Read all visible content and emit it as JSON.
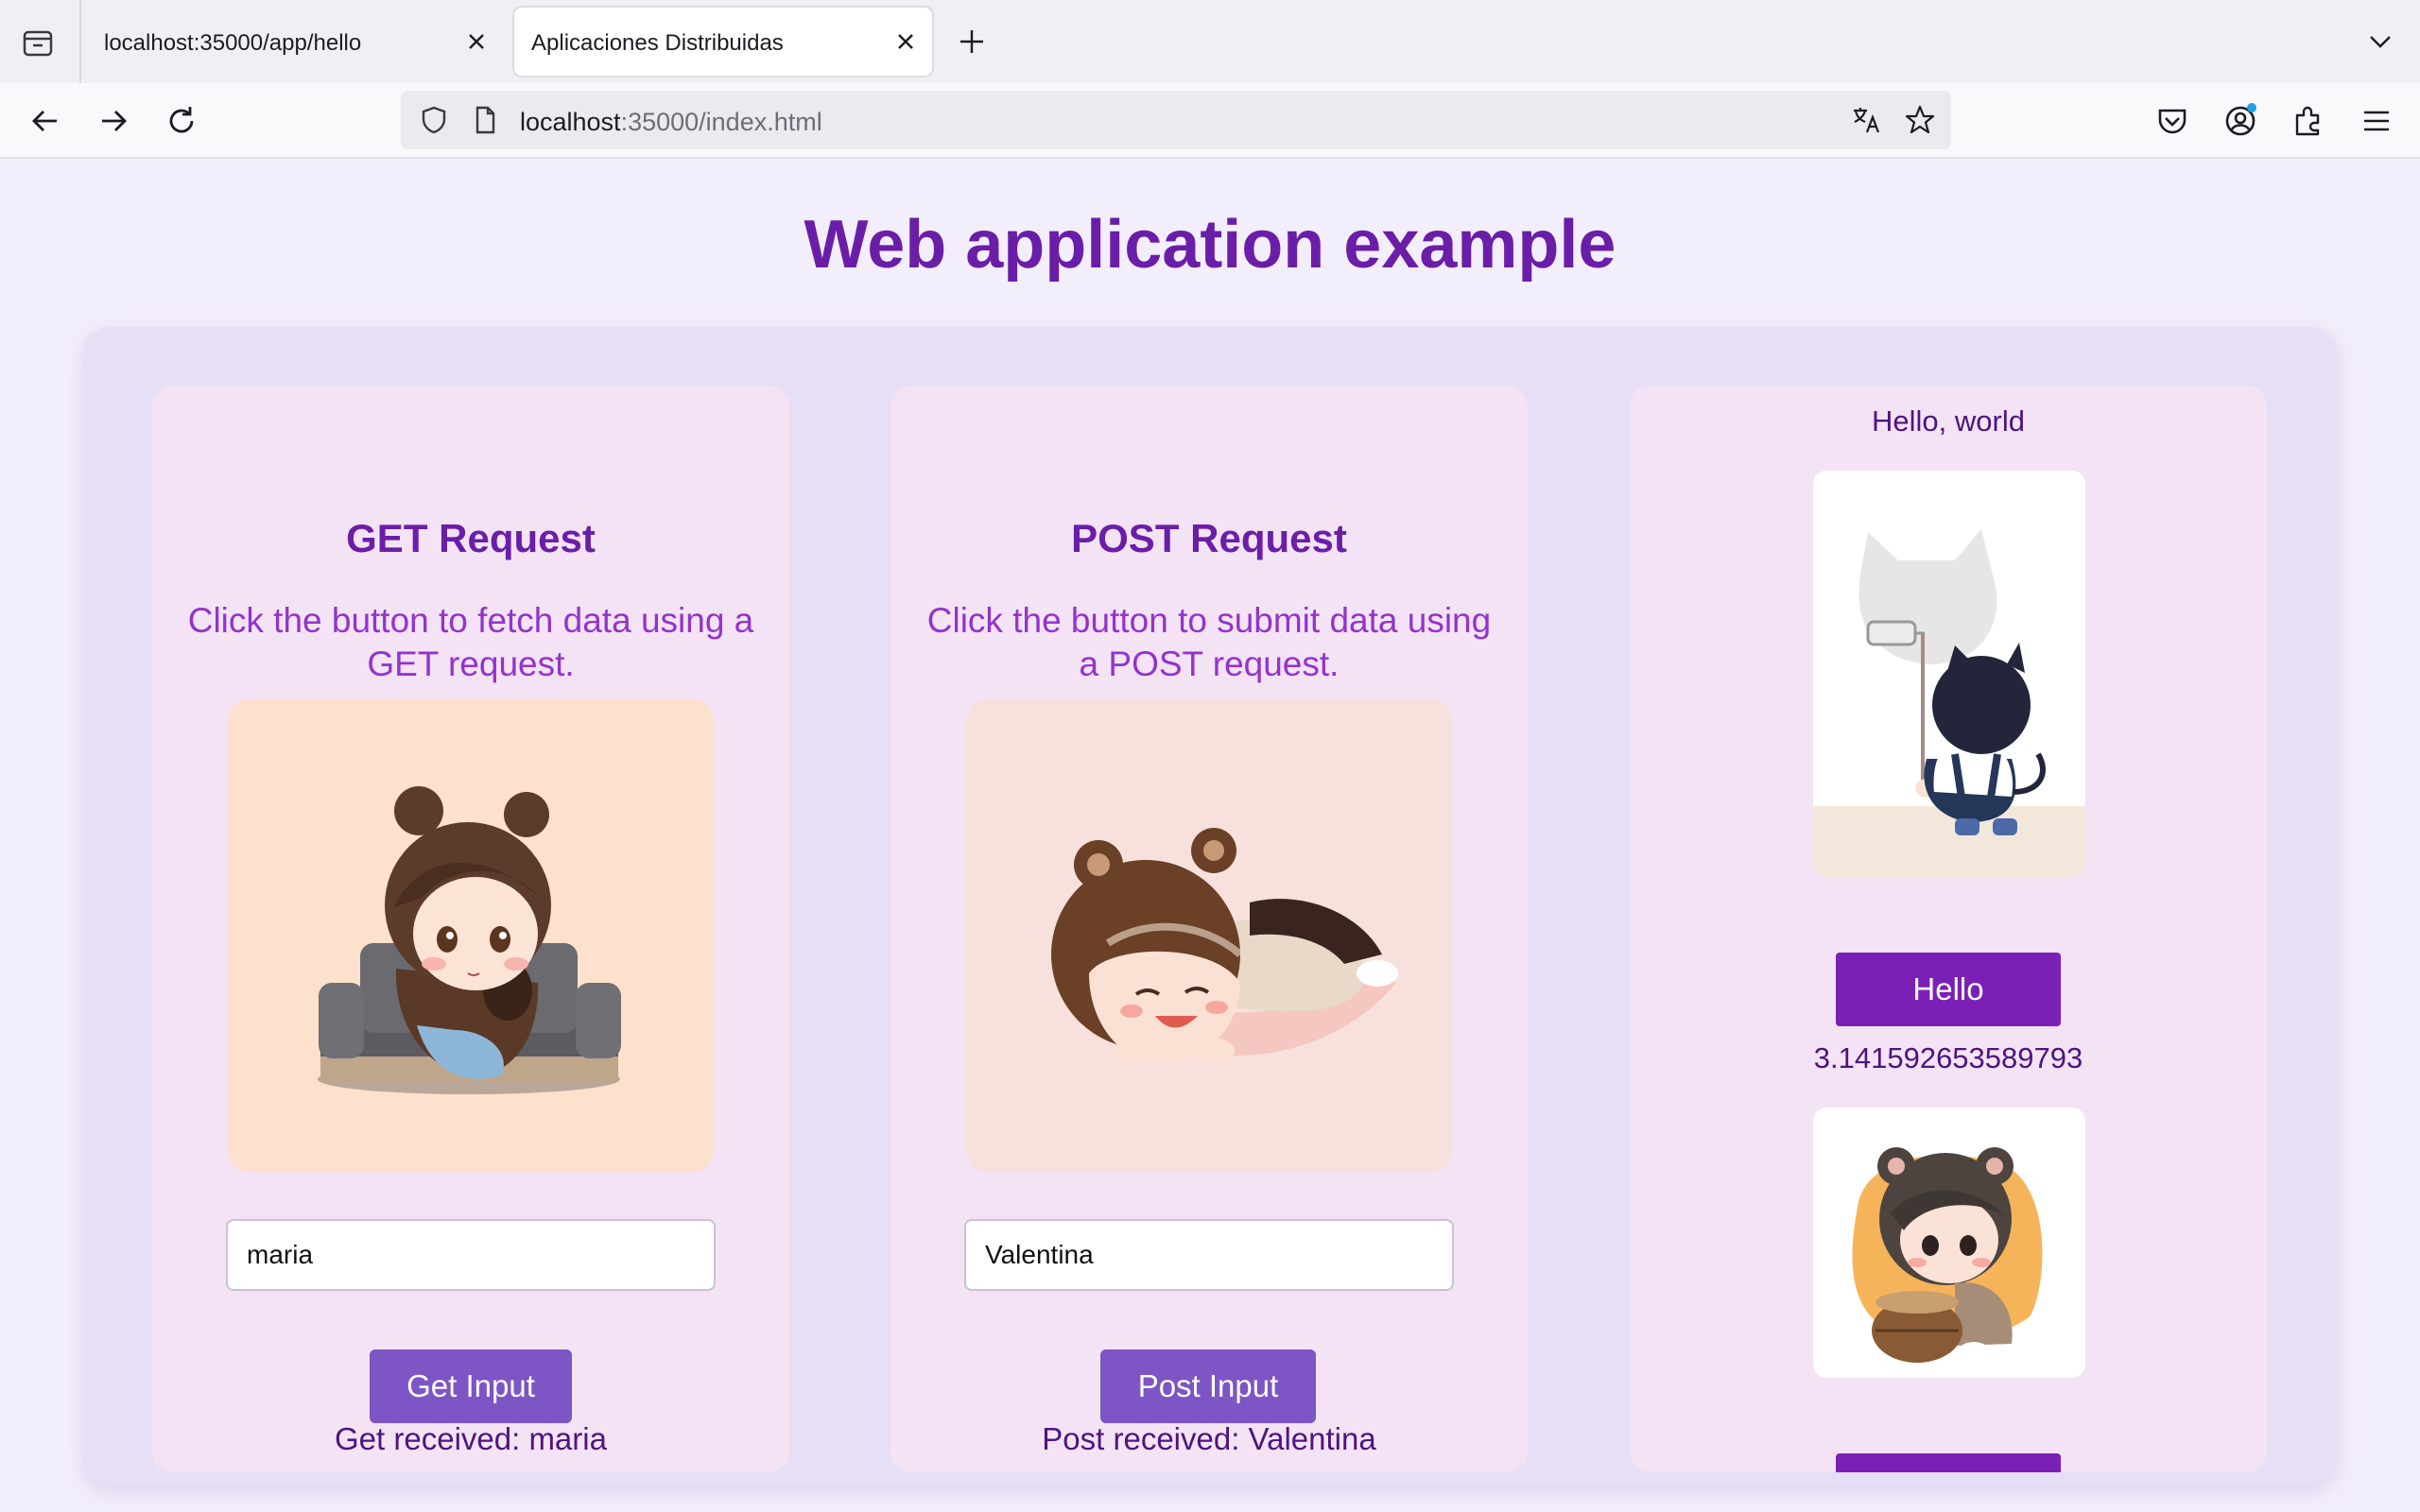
{
  "browser": {
    "tabs": [
      {
        "title": "localhost:35000/app/hello",
        "active": false
      },
      {
        "title": "Aplicaciones Distribuidas",
        "active": true
      }
    ],
    "url": {
      "host": "localhost",
      "rest": ":35000/index.html"
    }
  },
  "page": {
    "title": "Web application example",
    "get_card": {
      "title": "GET Request",
      "description": "Click the button to fetch data using a GET request.",
      "input_value": "maria",
      "button_label": "Get Input",
      "result": "Get received: maria"
    },
    "post_card": {
      "title": "POST Request",
      "description": "Click the button to submit data using a POST request.",
      "input_value": "Valentina",
      "button_label": "Post Input",
      "result": "Post received: Valentina"
    },
    "side_card": {
      "greeting": "Hello, world",
      "hello_button_label": "Hello",
      "pi_value": "3.141592653589793"
    }
  },
  "colors": {
    "title": "#6a1ea8",
    "description": "#9333cc",
    "button": "#7d55c4",
    "hello_button": "#7a20b7",
    "card_bg": "#f3e3f5",
    "container_bg": "#e6dff6"
  }
}
